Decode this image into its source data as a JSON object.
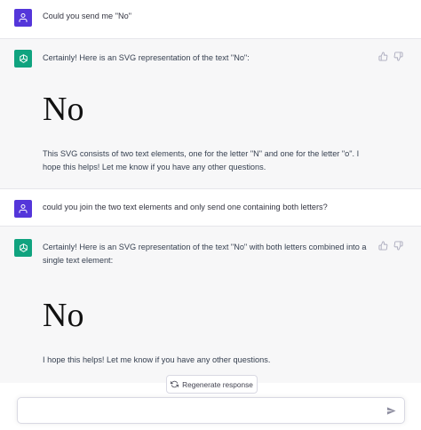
{
  "conversation": {
    "turns": [
      {
        "role": "user",
        "text": "Could you send me \"No\""
      },
      {
        "role": "assistant",
        "intro": "Certainly! Here is an SVG representation of the text \"No\":",
        "svg_text": "No",
        "outro": "This SVG consists of two text elements, one for the letter \"N\" and one for the letter \"o\". I hope this helps! Let me know if you have any other questions."
      },
      {
        "role": "user",
        "text": "could you join the two text elements and only send one containing both letters?"
      },
      {
        "role": "assistant",
        "intro": "Certainly! Here is an SVG representation of the text \"No\" with both letters combined into a single text element:",
        "svg_text": "No",
        "outro": "I hope this helps! Let me know if you have any other questions."
      }
    ]
  },
  "controls": {
    "regenerate_label": "Regenerate response",
    "input_value": "",
    "input_placeholder": ""
  },
  "colors": {
    "user_avatar": "#5436da",
    "assistant_avatar": "#10a37f",
    "assistant_bg": "#f7f7f8"
  },
  "icons": {
    "user_avatar": "user-icon",
    "assistant_avatar": "openai-logo-icon",
    "thumbs_up": "thumbs-up-icon",
    "thumbs_down": "thumbs-down-icon",
    "regenerate": "refresh-icon",
    "send": "send-icon"
  }
}
